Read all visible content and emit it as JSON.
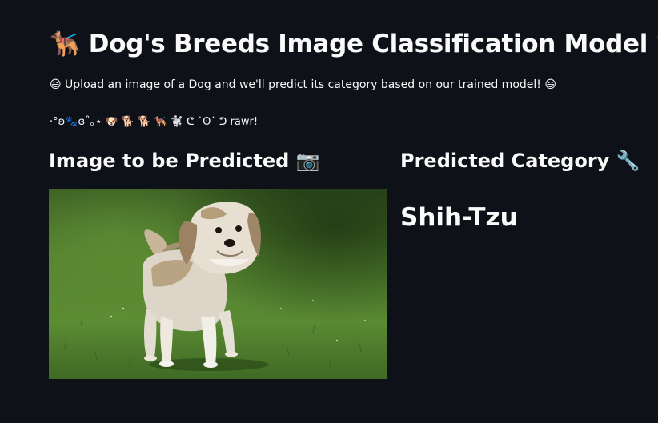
{
  "app": {
    "title": "🐕‍🦺 Dog's Breeds Image Classification Model 🦴",
    "subtitle": "😃 Upload an image of a Dog and we'll predict its category based on our trained model! 😃",
    "kaomoji_line": "·°ʚ🐾ɞ˚｡⋆ 🐶 🐕 🐕 🐕‍🦺 🐩 ᕦ ˙ʘ˙ ᕤ rawr!"
  },
  "left_column": {
    "heading": "Image to be Predicted 📷",
    "image_icon": "dog-photo-shih-tzu-on-grass"
  },
  "right_column": {
    "heading": "Predicted Category 🔧",
    "prediction": "Shih-Tzu"
  },
  "colors": {
    "background": "#0e1117",
    "text": "#fafafa"
  }
}
